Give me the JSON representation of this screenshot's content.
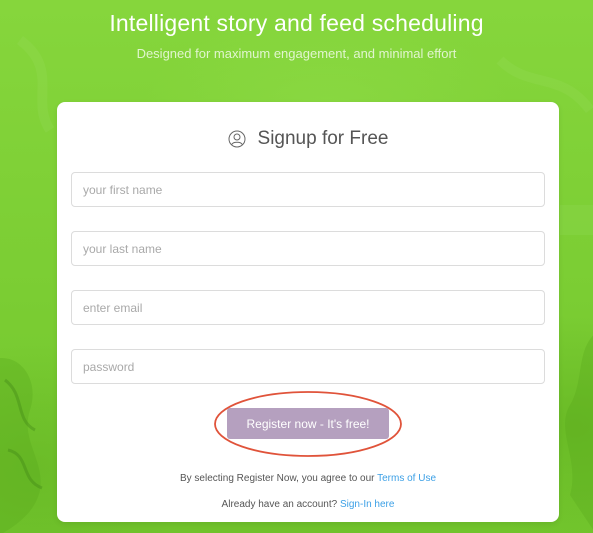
{
  "hero": {
    "title": "Intelligent story and feed scheduling",
    "subtitle": "Designed for maximum engagement, and minimal effort"
  },
  "signup": {
    "title": "Signup for Free",
    "icon": "user-circle-icon",
    "fields": {
      "first_name_placeholder": "your first name",
      "last_name_placeholder": "your last name",
      "email_placeholder": "enter email",
      "password_placeholder": "password"
    },
    "register_label": "Register now - It's free!",
    "terms_prefix": "By selecting Register Now, you agree to our",
    "terms_link": "Terms of Use",
    "signin_prefix": "Already have an account?",
    "signin_link": "Sign-In here"
  },
  "colors": {
    "background": "#7fd135",
    "register_button": "#b5a0bf",
    "link": "#3ca0e6",
    "highlight_ring": "#e0533a"
  }
}
